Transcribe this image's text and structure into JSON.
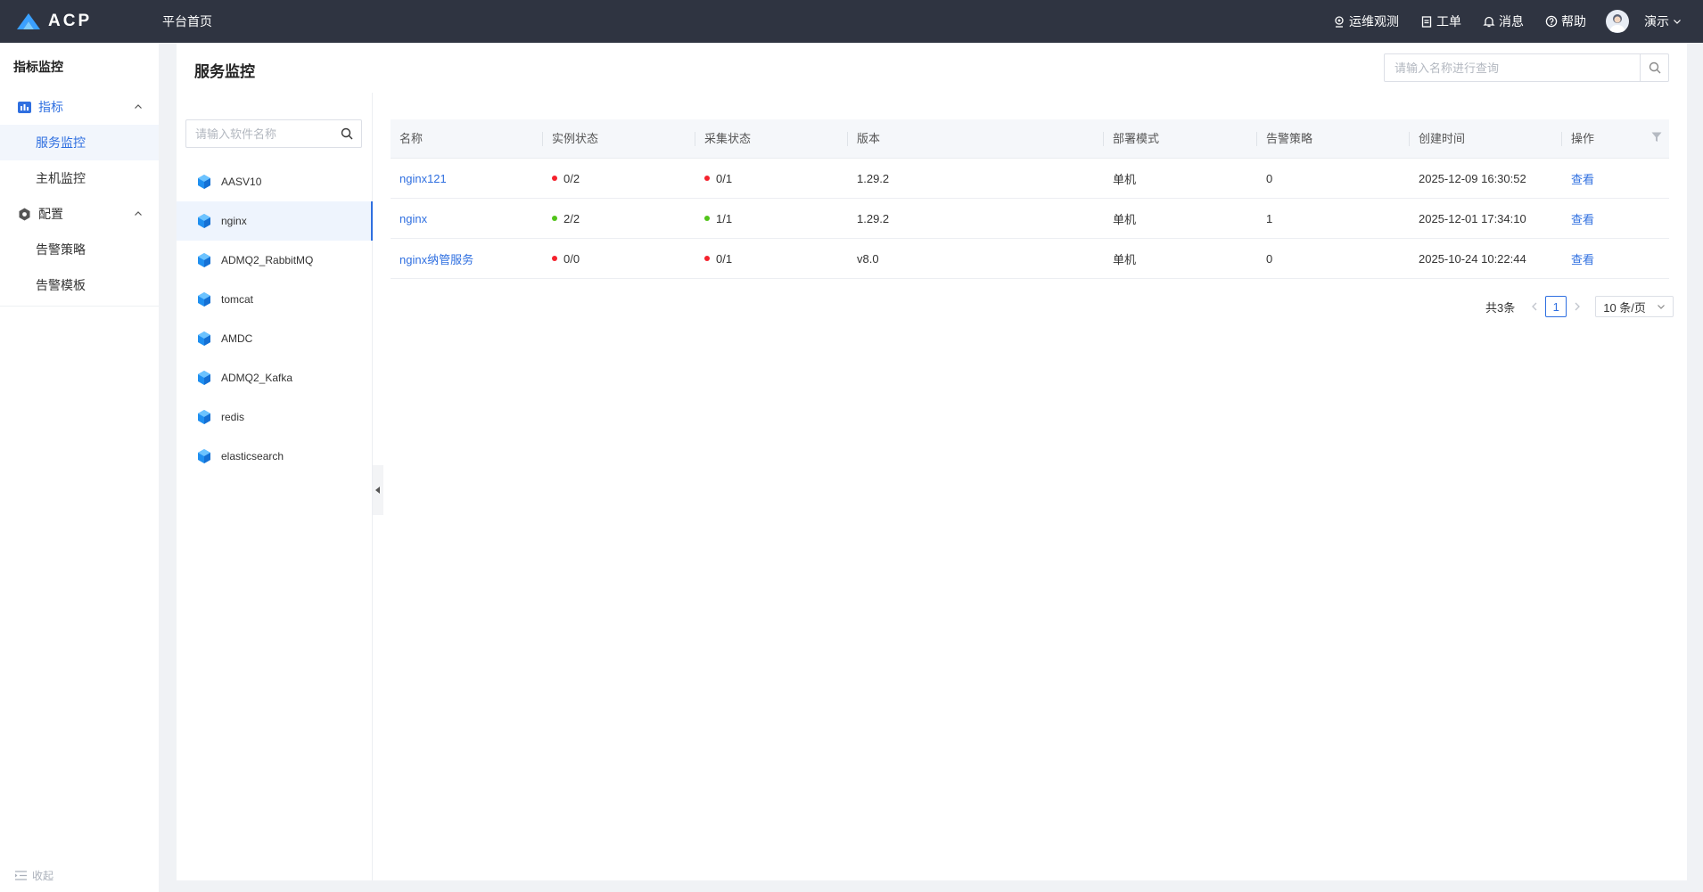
{
  "colors": {
    "topbar": "#2f3441",
    "accent": "#2f6fe0",
    "status_red": "#f5222d",
    "status_green": "#52c41a"
  },
  "header": {
    "logo_text": "ACP",
    "home_label": "平台首页",
    "nav": [
      {
        "label": "运维观测",
        "icon": "monitor-icon"
      },
      {
        "label": "工单",
        "icon": "clipboard-icon"
      },
      {
        "label": "消息",
        "icon": "bell-icon"
      },
      {
        "label": "帮助",
        "icon": "help-icon"
      }
    ],
    "user_name": "演示"
  },
  "sidebar": {
    "title": "指标监控",
    "groups": [
      {
        "label": "指标",
        "icon": "bar-chart-icon",
        "items": [
          "服务监控",
          "主机监控"
        ]
      },
      {
        "label": "配置",
        "icon": "gear-icon",
        "items": [
          "告警策略",
          "告警模板"
        ]
      }
    ],
    "active_item": "服务监控",
    "collapse_label": "收起"
  },
  "main": {
    "title": "服务监控",
    "search_placeholder": "请输入名称进行查询",
    "software_search_placeholder": "请输入软件名称",
    "software_list": [
      "AASV10",
      "nginx",
      "ADMQ2_RabbitMQ",
      "tomcat",
      "AMDC",
      "ADMQ2_Kafka",
      "redis",
      "elasticsearch"
    ],
    "active_software": "nginx"
  },
  "table": {
    "columns": [
      "名称",
      "实例状态",
      "采集状态",
      "版本",
      "部署模式",
      "告警策略",
      "创建时间",
      "操作"
    ],
    "rows": [
      {
        "name": "nginx121",
        "instance_status": "0/2",
        "instance_color": "red",
        "collect_status": "0/1",
        "collect_color": "red",
        "version": "1.29.2",
        "deploy_mode": "单机",
        "alert_policy": "0",
        "created": "2025-12-09 16:30:52",
        "action": "查看"
      },
      {
        "name": "nginx",
        "instance_status": "2/2",
        "instance_color": "green",
        "collect_status": "1/1",
        "collect_color": "green",
        "version": "1.29.2",
        "deploy_mode": "单机",
        "alert_policy": "1",
        "created": "2025-12-01 17:34:10",
        "action": "查看"
      },
      {
        "name": "nginx纳管服务",
        "instance_status": "0/0",
        "instance_color": "red",
        "collect_status": "0/1",
        "collect_color": "red",
        "version": "v8.0",
        "deploy_mode": "单机",
        "alert_policy": "0",
        "created": "2025-10-24 10:22:44",
        "action": "查看"
      }
    ]
  },
  "pagination": {
    "total_label": "共3条",
    "current_page": "1",
    "page_size_label": "10 条/页"
  }
}
